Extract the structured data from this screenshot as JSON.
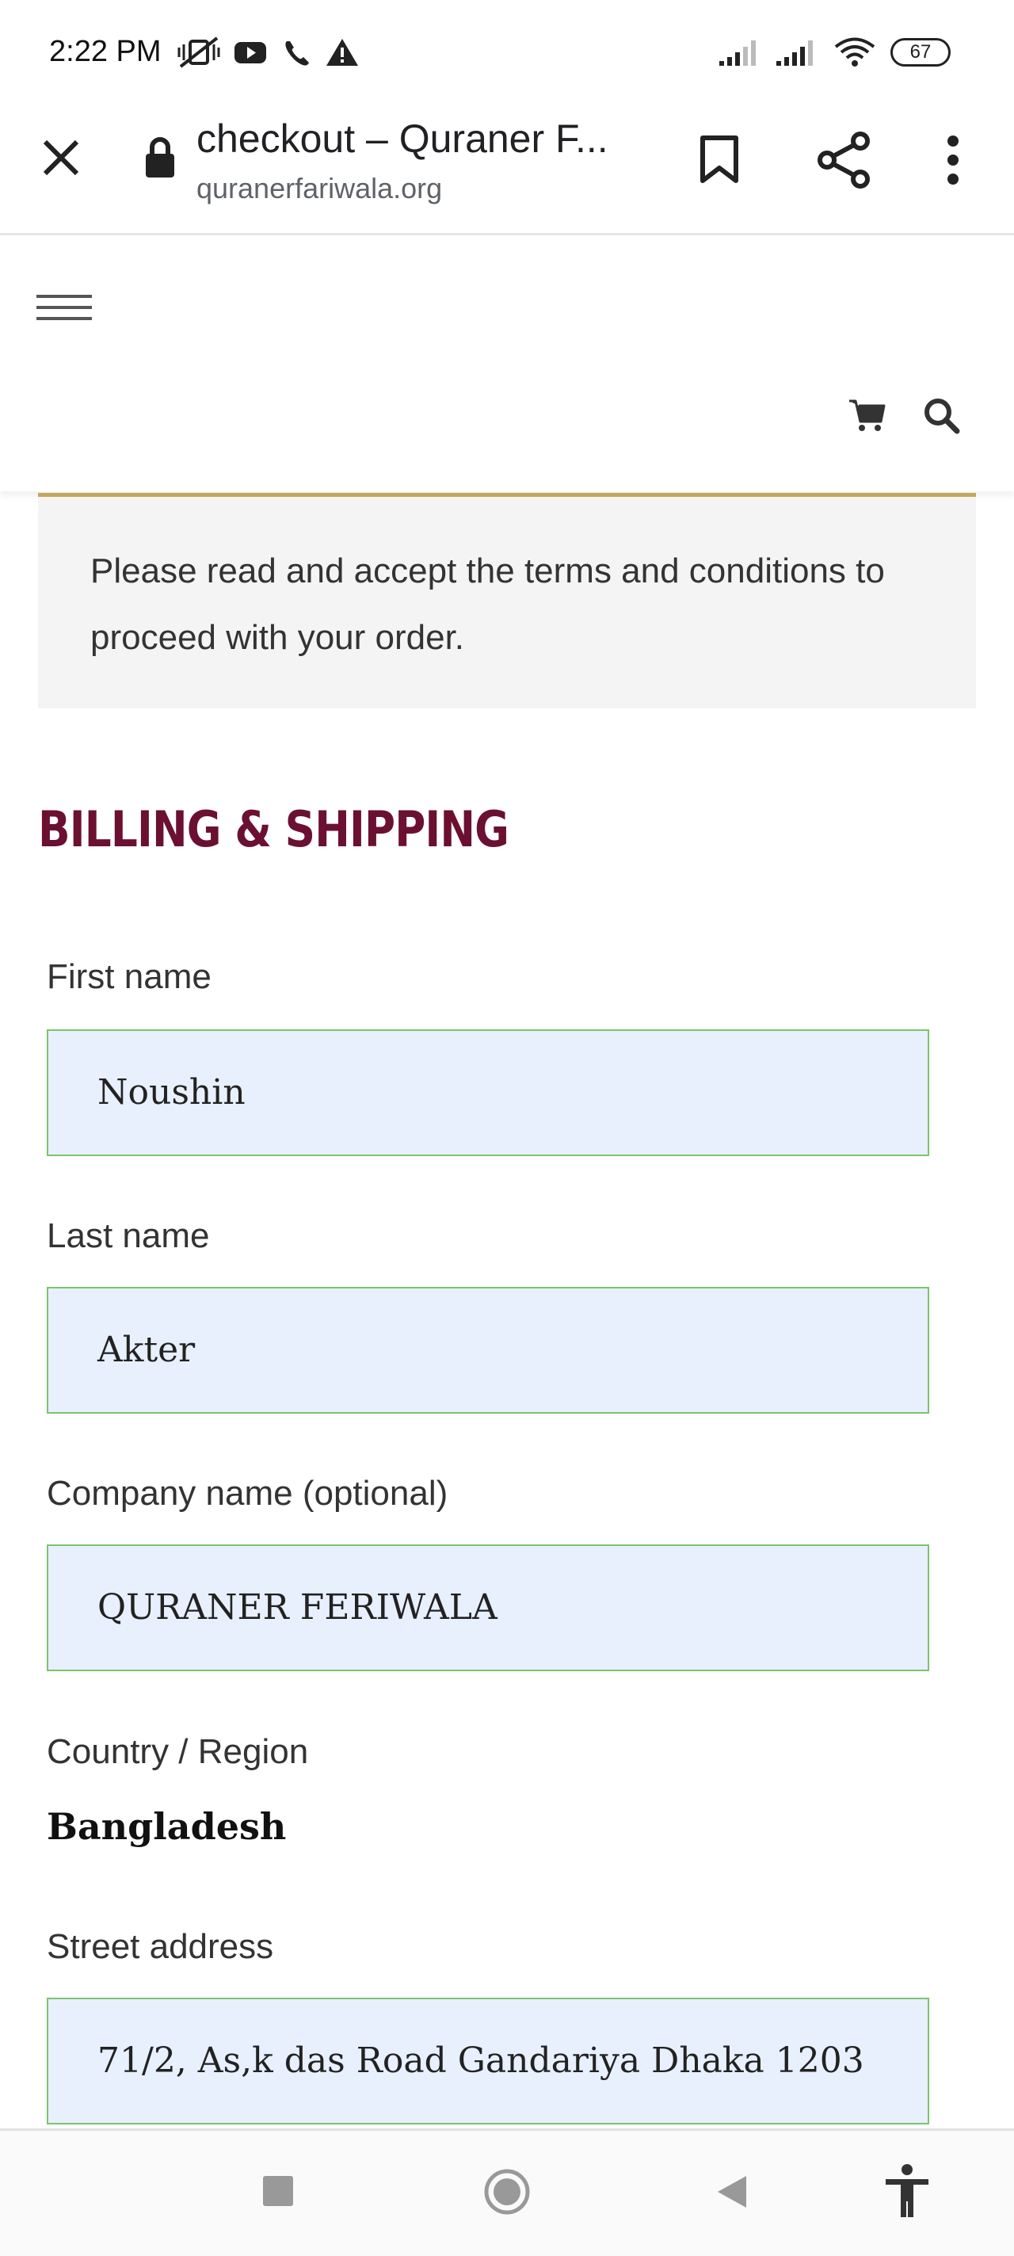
{
  "status_bar": {
    "time": "2:22 PM",
    "battery": "67",
    "icons": [
      "muted-vibrate-icon",
      "youtube-icon",
      "phone-icon",
      "warning-icon",
      "signal-icon",
      "signal-icon",
      "wifi-icon",
      "battery-icon"
    ]
  },
  "browser": {
    "title": "checkout – Quraner F...",
    "url": "quranerfariwala.org",
    "icons": [
      "close-icon",
      "lock-icon",
      "bookmark-icon",
      "share-icon",
      "more-vert-icon"
    ]
  },
  "site_header": {
    "icons": [
      "hamburger-menu-icon",
      "cart-icon",
      "search-icon"
    ]
  },
  "notice": {
    "text": "Please read and accept the terms and conditions to proceed with your order."
  },
  "billing": {
    "heading": "BILLING & SHIPPING",
    "first_name_label": "First name",
    "first_name_value": "Noushin",
    "last_name_label": "Last name",
    "last_name_value": "Akter",
    "company_label": "Company name (optional)",
    "company_value": "QURANER FERIWALA",
    "country_label": "Country / Region",
    "country_value": "Bangladesh",
    "street_label": "Street address",
    "street_value": "71/2, As,k das Road Gandariya Dhaka 1203"
  },
  "nav_bar": {
    "icons": [
      "recents-icon",
      "home-icon",
      "back-icon",
      "accessibility-icon"
    ]
  },
  "colors": {
    "heading": "#6b1030",
    "notice_border": "#c2a75c",
    "input_bg": "#e8f0fe",
    "input_border": "#7cc46a"
  }
}
